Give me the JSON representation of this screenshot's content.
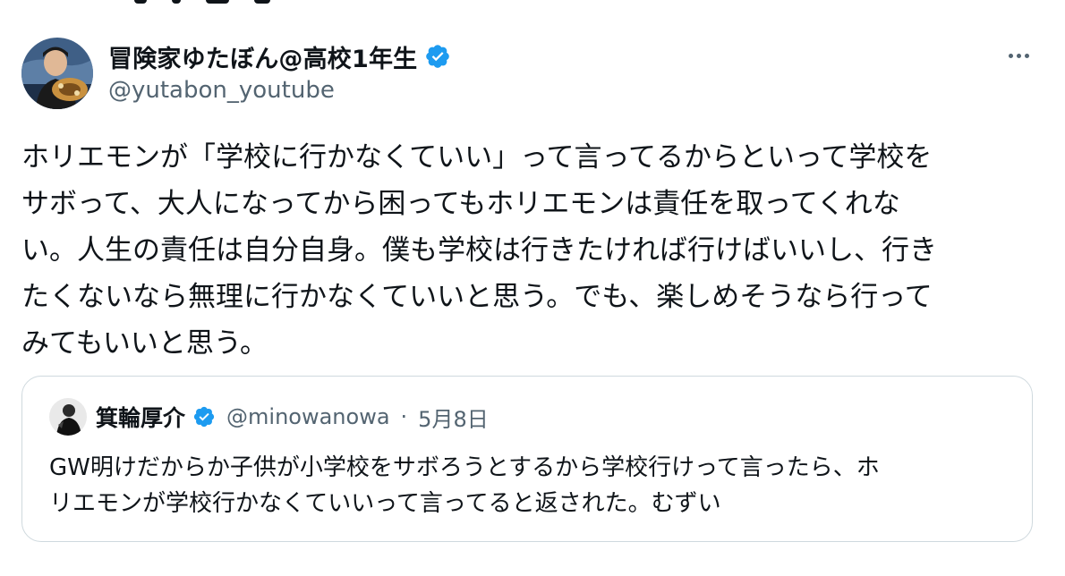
{
  "tweet": {
    "display_name": "冒険家ゆたぼん@高校1年生",
    "handle": "@yutabon_youtube",
    "verified_icon": "verified-badge-icon",
    "more_icon": "more-options-icon",
    "body_lines": [
      "ホリエモンが「学校に行かなくていい」って言ってるからといって学校を",
      "サボって、大人になってから困ってもホリエモンは責任を取ってくれな",
      "い。人生の責任は自分自身。僕も学校は行きたければ行けばいいし、行き",
      "たくないなら無理に行かなくていいと思う。でも、楽しめそうなら行って",
      "みてもいいと思う。"
    ]
  },
  "quoted_tweet": {
    "display_name": "箕輪厚介",
    "handle": "@minowanowa",
    "separator": "·",
    "date": "5月8日",
    "verified_icon": "verified-badge-icon",
    "body_lines": [
      "GW明けだからか子供が小学校をサボろうとするから学校行けって言ったら、ホ",
      "リエモンが学校行かなくていいって言ってると返された。むずい"
    ]
  },
  "colors": {
    "text": "#0f1419",
    "secondary": "#536471",
    "verified": "#1d9bf0",
    "border": "#cfd9de"
  }
}
